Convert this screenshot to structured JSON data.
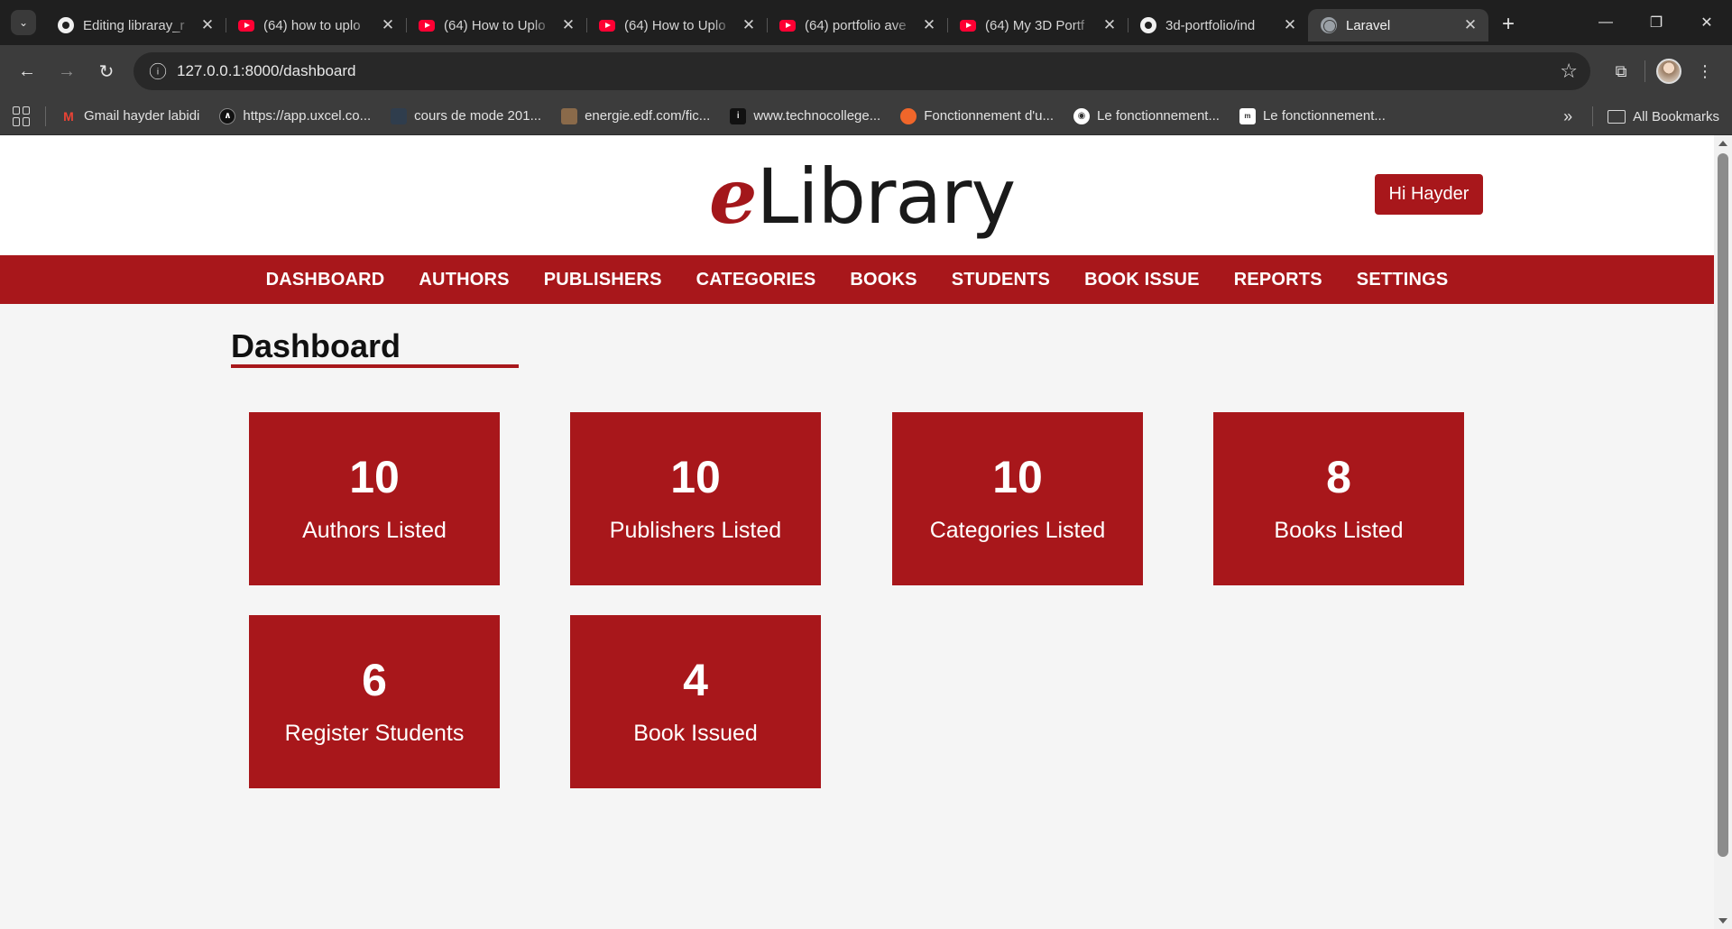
{
  "browser": {
    "tabs": [
      {
        "title": "Editing libraray_r",
        "icon": "github"
      },
      {
        "title": "(64) how to uplo",
        "icon": "youtube"
      },
      {
        "title": "(64) How to Uplo",
        "icon": "youtube"
      },
      {
        "title": "(64) How to Uplo",
        "icon": "youtube"
      },
      {
        "title": "(64) portfolio ave",
        "icon": "youtube"
      },
      {
        "title": "(64) My 3D Portf",
        "icon": "youtube"
      },
      {
        "title": "3d-portfolio/ind",
        "icon": "github"
      },
      {
        "title": "Laravel",
        "icon": "globe",
        "active": true
      }
    ],
    "url": "127.0.0.1:8000/dashboard",
    "bookmarks": [
      {
        "label": "Gmail hayder labidi",
        "icon": "gmail"
      },
      {
        "label": "https://app.uxcel.co...",
        "icon": "uxcel"
      },
      {
        "label": "cours de mode 201...",
        "icon": "doc"
      },
      {
        "label": "energie.edf.com/fic...",
        "icon": "image"
      },
      {
        "label": "www.technocollege...",
        "icon": "techno"
      },
      {
        "label": "Fonctionnement d'u...",
        "icon": "orange-hex"
      },
      {
        "label": "Le fonctionnement...",
        "icon": "circle"
      },
      {
        "label": "Le fonctionnement...",
        "icon": "mg"
      }
    ],
    "all_bookmarks": "All Bookmarks"
  },
  "site": {
    "logo_prefix": "e",
    "logo_rest": "Library",
    "greeting": "Hi Hayder",
    "nav": [
      "DASHBOARD",
      "AUTHORS",
      "PUBLISHERS",
      "CATEGORIES",
      "BOOKS",
      "STUDENTS",
      "BOOK ISSUE",
      "REPORTS",
      "SETTINGS"
    ],
    "page_title": "Dashboard",
    "cards": [
      {
        "count": "10",
        "label": "Authors Listed"
      },
      {
        "count": "10",
        "label": "Publishers Listed"
      },
      {
        "count": "10",
        "label": "Categories Listed"
      },
      {
        "count": "8",
        "label": "Books Listed"
      },
      {
        "count": "6",
        "label": "Register Students"
      },
      {
        "count": "4",
        "label": "Book Issued"
      }
    ]
  },
  "colors": {
    "brand": "#a8171b",
    "page_bg": "#f5f5f5",
    "chrome_dark": "#1f1f1f",
    "chrome_toolbar": "#3c3c3c"
  }
}
